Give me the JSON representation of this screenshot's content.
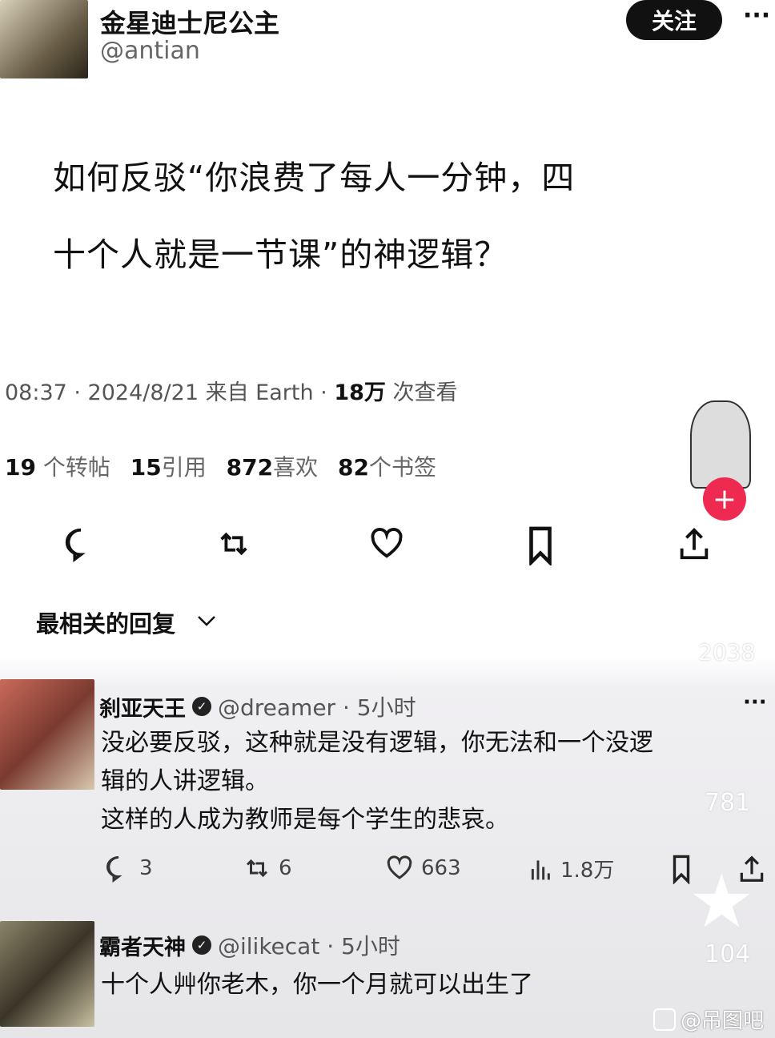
{
  "post": {
    "author_name": "金星迪士尼公主",
    "author_handle": "@antian",
    "follow_label": "关注",
    "more_label": "···",
    "title_line1": "如何反驳“你浪费了每人一分钟，四",
    "title_line2": "十个人就是一节课”的神逻辑？",
    "time": "08:37 · 2024/8/21 来自 Earth · ",
    "views_count": "18万",
    "views_label": " 次查看",
    "stats": [
      {
        "count": "19",
        "label": " 个转帖"
      },
      {
        "count": "15",
        "label": "引用"
      },
      {
        "count": "872",
        "label": "喜欢"
      },
      {
        "count": "82",
        "label": "个书签"
      }
    ]
  },
  "replies_sort": {
    "label": "最相关的回复"
  },
  "replies": [
    {
      "name": "刹亚天王",
      "handle": "@dreamer · 5小时",
      "lines": [
        "没必要反驳，这种就是没有逻辑，你无法和一个没逻",
        "辑的人讲逻辑。",
        "这样的人成为教师是每个学生的悲哀。"
      ],
      "replies": "3",
      "reposts": "6",
      "likes": "663",
      "views": "1.8万"
    },
    {
      "name": "霸者天神",
      "handle": "@ilikecat · 5小时",
      "lines": [
        "十个人艸你老木，你一个月就可以出生了"
      ]
    }
  ],
  "overlay": {
    "likes": "2038",
    "comments": "781",
    "favorites": "104"
  },
  "watermark": "@吊图吧",
  "colors": {
    "accent": "#ee2a50"
  }
}
